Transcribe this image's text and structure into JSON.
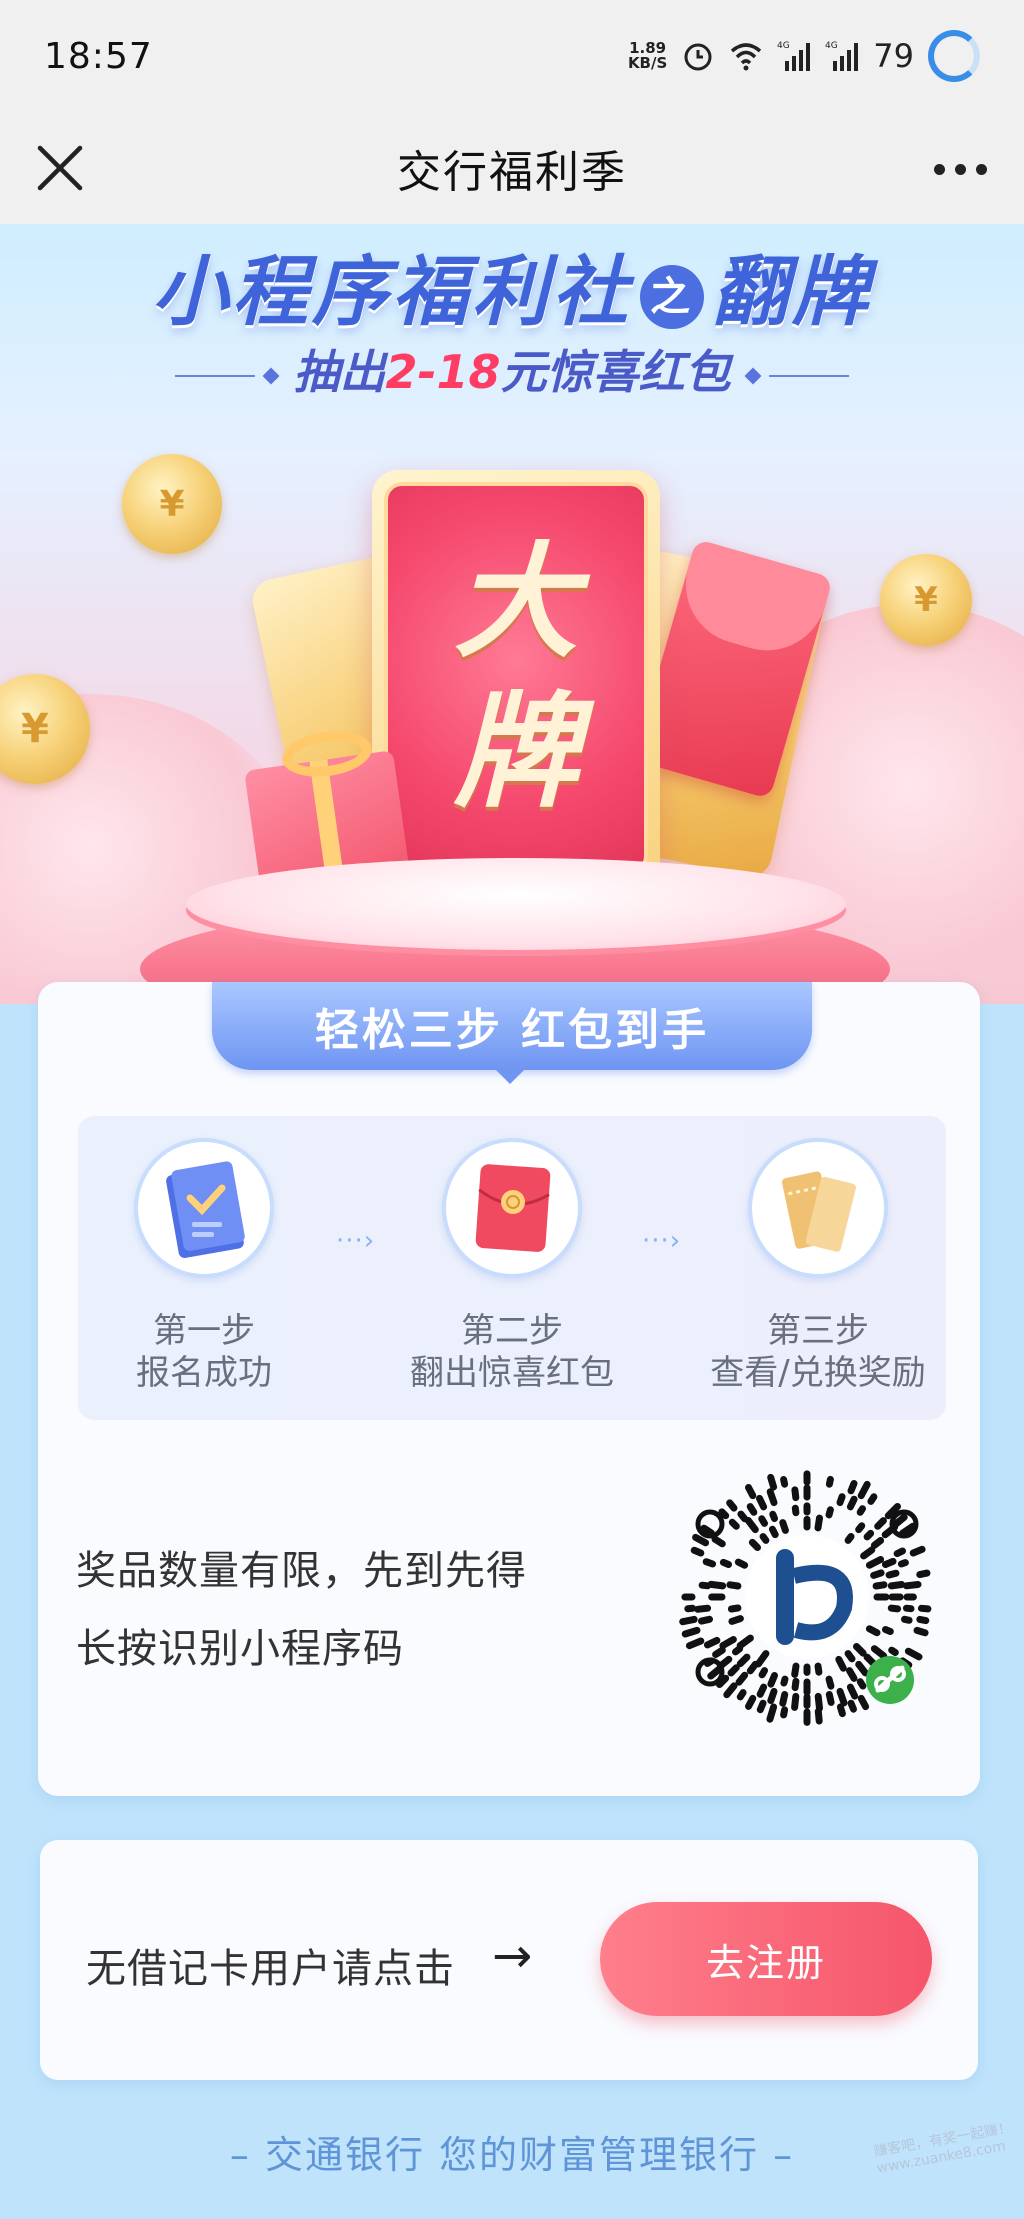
{
  "status_bar": {
    "time": "18:57",
    "net_speed_value": "1.89",
    "net_speed_unit": "KB/S",
    "network_1": "4G",
    "network_2": "4G",
    "battery": "79"
  },
  "nav": {
    "title": "交行福利季",
    "close_icon": "close-icon",
    "more_icon": "more-icon"
  },
  "banner": {
    "title_part1": "小程序福利社",
    "title_connector": "之",
    "title_part2": "翻牌",
    "subtitle_prefix": "抽出",
    "subtitle_highlight": "2-18",
    "subtitle_suffix": "元惊喜红包",
    "card_char_1": "大",
    "card_char_2": "牌",
    "coin_symbol": "¥"
  },
  "steps": {
    "header": "轻松三步 红包到手",
    "items": [
      {
        "label": "第一步",
        "desc": "报名成功",
        "icon": "clipboard-icon"
      },
      {
        "label": "第二步",
        "desc": "翻出惊喜红包",
        "icon": "red-envelope-icon"
      },
      {
        "label": "第三步",
        "desc": "查看/兑换奖励",
        "icon": "coupon-icon"
      }
    ],
    "arrow": "···›"
  },
  "qr": {
    "line1": "奖品数量有限，先到先得",
    "line2": "长按识别小程序码"
  },
  "register": {
    "text": "无借记卡用户请点击",
    "arrow": "→",
    "button": "去注册"
  },
  "footer": "– 交通银行 您的财富管理银行 –",
  "watermark": "赚客吧，有奖一起赚！ www.zuanke8.com",
  "colors": {
    "accent_blue": "#4b6fe0",
    "accent_red": "#f5556a",
    "footer_blue": "#5f94d8"
  }
}
